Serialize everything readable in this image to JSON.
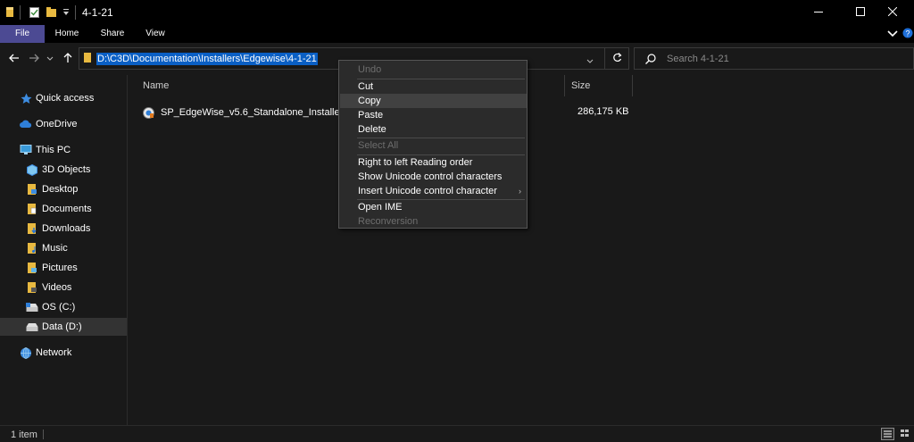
{
  "window": {
    "title": "4-1-21",
    "colors": {
      "titlebar": "#000000",
      "file_tab": "#4c4a93",
      "background": "#191919",
      "selection": "#0a5fc4"
    },
    "icons": [
      "folder-icon",
      "properties-icon",
      "new-folder-icon",
      "customize-dropdown-icon",
      "minimize-icon",
      "maximize-icon",
      "close-icon"
    ]
  },
  "ribbon": {
    "tabs": [
      {
        "label": "File"
      },
      {
        "label": "Home"
      },
      {
        "label": "Share"
      },
      {
        "label": "View"
      }
    ]
  },
  "address": {
    "path": "D:\\C3D\\Documentation\\Installers\\Edgewise\\4-1-21",
    "search_placeholder": "Search 4-1-21"
  },
  "sidebar": {
    "items": [
      {
        "label": "Quick access",
        "icon": "star-icon"
      },
      {
        "label": "OneDrive",
        "icon": "cloud-icon"
      },
      {
        "label": "This PC",
        "icon": "pc-icon"
      },
      {
        "label": "3D Objects",
        "icon": "cube-icon"
      },
      {
        "label": "Desktop",
        "icon": "desktop-folder-icon"
      },
      {
        "label": "Documents",
        "icon": "documents-icon"
      },
      {
        "label": "Downloads",
        "icon": "downloads-icon"
      },
      {
        "label": "Music",
        "icon": "music-icon"
      },
      {
        "label": "Pictures",
        "icon": "pictures-icon"
      },
      {
        "label": "Videos",
        "icon": "videos-icon"
      },
      {
        "label": "OS (C:)",
        "icon": "drive-icon"
      },
      {
        "label": "Data (D:)",
        "icon": "drive-icon",
        "selected": true
      },
      {
        "label": "Network",
        "icon": "network-icon"
      }
    ]
  },
  "files": {
    "columns": {
      "name": "Name",
      "size": "Size"
    },
    "rows": [
      {
        "name": "SP_EdgeWise_v5.6_Standalone_Installer_...",
        "size": "286,175 KB",
        "icon": "installer-icon"
      }
    ]
  },
  "status": {
    "item_count": "1 item"
  },
  "context_menu": {
    "items": [
      {
        "label": "Undo",
        "disabled": true
      },
      {
        "sep": true
      },
      {
        "label": "Cut"
      },
      {
        "label": "Copy",
        "hover": true
      },
      {
        "label": "Paste"
      },
      {
        "label": "Delete"
      },
      {
        "sep": true
      },
      {
        "label": "Select All",
        "disabled": true
      },
      {
        "sep": true
      },
      {
        "label": "Right to left Reading order"
      },
      {
        "label": "Show Unicode control characters"
      },
      {
        "label": "Insert Unicode control character",
        "submenu": true
      },
      {
        "sep": true
      },
      {
        "label": "Open IME"
      },
      {
        "label": "Reconversion",
        "disabled": true
      }
    ]
  }
}
